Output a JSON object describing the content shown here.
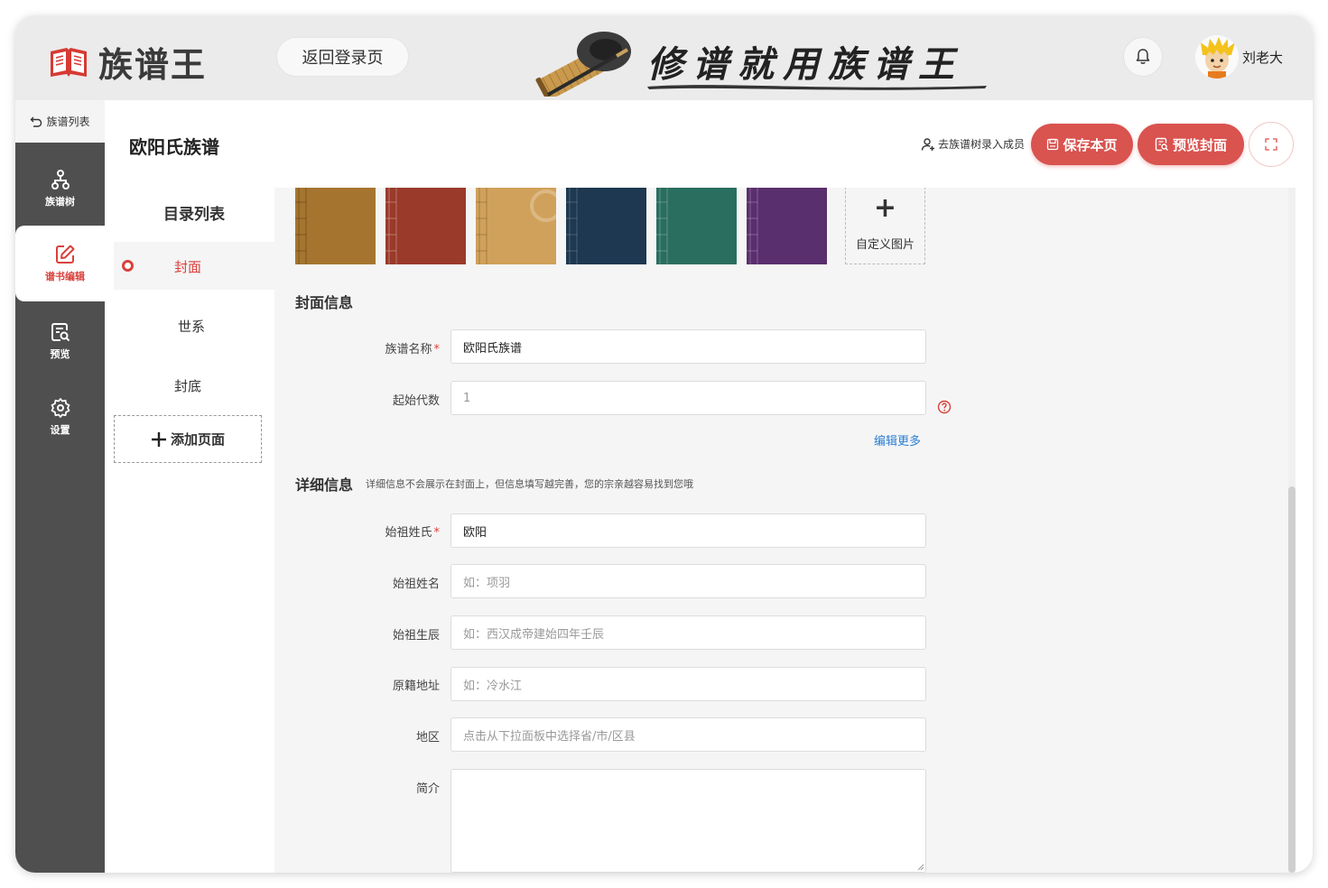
{
  "header": {
    "app_name": "族谱王",
    "back_login": "返回登录页",
    "banner_slogan": "修谱就用族谱王",
    "username": "刘老大"
  },
  "rail": {
    "back_label": "族谱列表",
    "items": [
      {
        "label": "族谱树",
        "icon": "tree-icon"
      },
      {
        "label": "谱书编辑",
        "icon": "edit-icon",
        "active": true
      },
      {
        "label": "预览",
        "icon": "preview-icon"
      },
      {
        "label": "设置",
        "icon": "gear-icon"
      }
    ]
  },
  "toolbar": {
    "page_title": "欧阳氏族谱",
    "goto_tree": "去族谱树录入成员",
    "save": "保存本页",
    "preview_cover": "预览封面"
  },
  "toc": {
    "title": "目录列表",
    "items": [
      "封面",
      "世系",
      "封底"
    ],
    "active_index": 0,
    "add_page": "添加页面"
  },
  "covers": {
    "swatch_colors": [
      "#a5752f",
      "#9a3a2a",
      "#d0a15a",
      "#1d3850",
      "#2a6e60",
      "#5a2f6e"
    ],
    "custom_label": "自定义图片"
  },
  "cover_info": {
    "title": "封面信息",
    "name_label": "族谱名称",
    "name_value": "欧阳氏族谱",
    "gen_label": "起始代数",
    "gen_value": "1",
    "edit_more": "编辑更多"
  },
  "detail_info": {
    "title": "详细信息",
    "note": "详细信息不会展示在封面上，但信息填写越完善，您的宗亲越容易找到您哦",
    "surname_label": "始祖姓氏",
    "surname_value": "欧阳",
    "fullname_label": "始祖姓名",
    "fullname_placeholder": "如：项羽",
    "birth_label": "始祖生辰",
    "birth_placeholder": "如：西汉成帝建始四年壬辰",
    "origin_label": "原籍地址",
    "origin_placeholder": "如：冷水江",
    "region_label": "地区",
    "region_placeholder": "点击从下拉面板中选择省/市/区县",
    "intro_label": "简介",
    "intro_value": ""
  },
  "colors": {
    "accent": "#d9534f",
    "link": "#2a7fd4",
    "rail_bg": "#4f4f4f"
  }
}
